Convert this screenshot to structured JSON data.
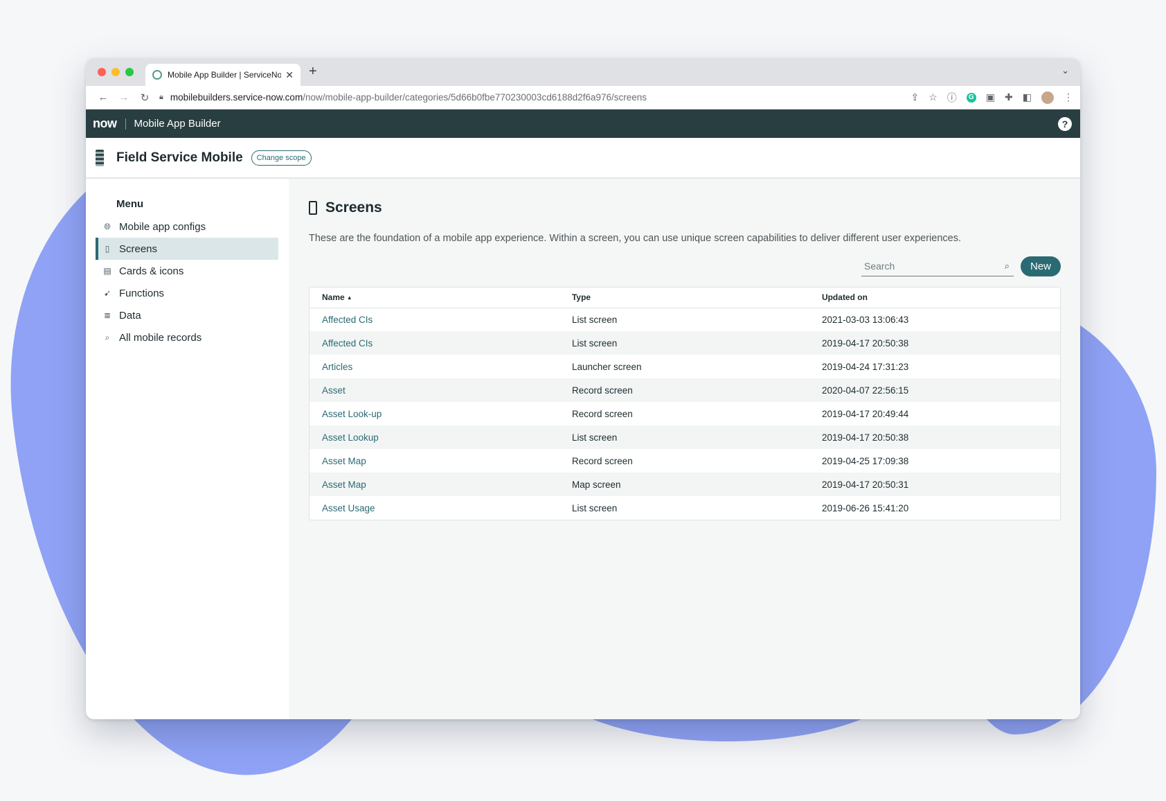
{
  "browser": {
    "tab_title": "Mobile App Builder | ServiceNow",
    "url_host": "mobilebuilders.service-now.com",
    "url_path": "/now/mobile-app-builder/categories/5d66b0fbe770230003cd6188d2f6a976/screens",
    "traffic_lights": [
      "#ff5f57",
      "#febc2e",
      "#28c840"
    ]
  },
  "appbar": {
    "logo": "now",
    "title": "Mobile App Builder",
    "help_icon": "?"
  },
  "scope": {
    "title": "Field Service Mobile",
    "change_label": "Change scope"
  },
  "sidebar": {
    "heading": "Menu",
    "items": [
      {
        "label": "Mobile app configs",
        "icon": "globe-icon"
      },
      {
        "label": "Screens",
        "icon": "phone-icon",
        "active": true
      },
      {
        "label": "Cards & icons",
        "icon": "card-icon"
      },
      {
        "label": "Functions",
        "icon": "function-icon"
      },
      {
        "label": "Data",
        "icon": "database-icon"
      },
      {
        "label": "All mobile records",
        "icon": "search-icon"
      }
    ]
  },
  "main": {
    "title": "Screens",
    "description": "These are the foundation of a mobile app experience. Within a screen, you can use unique screen capabilities to deliver different user experiences.",
    "search_placeholder": "Search",
    "new_label": "New",
    "columns": [
      "Name",
      "Type",
      "Updated on"
    ],
    "rows": [
      {
        "name": "Affected CIs",
        "type": "List screen",
        "updated": "2021-03-03 13:06:43"
      },
      {
        "name": "Affected CIs",
        "type": "List screen",
        "updated": "2019-04-17 20:50:38"
      },
      {
        "name": "Articles",
        "type": "Launcher screen",
        "updated": "2019-04-24 17:31:23"
      },
      {
        "name": "Asset",
        "type": "Record screen",
        "updated": "2020-04-07 22:56:15"
      },
      {
        "name": "Asset Look-up",
        "type": "Record screen",
        "updated": "2019-04-17 20:49:44"
      },
      {
        "name": "Asset Lookup",
        "type": "List screen",
        "updated": "2019-04-17 20:50:38"
      },
      {
        "name": "Asset Map",
        "type": "Record screen",
        "updated": "2019-04-25 17:09:38"
      },
      {
        "name": "Asset Map",
        "type": "Map screen",
        "updated": "2019-04-17 20:50:31"
      },
      {
        "name": "Asset Usage",
        "type": "List screen",
        "updated": "2019-06-26 15:41:20"
      }
    ]
  }
}
